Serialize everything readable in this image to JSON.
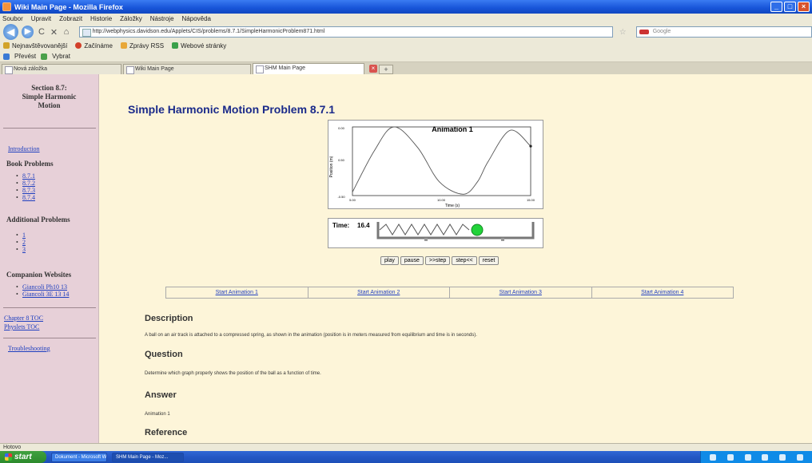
{
  "window": {
    "title": "Wiki Main Page - Mozilla Firefox",
    "controls": {
      "minimize": "_",
      "maximize": "□",
      "close": "×"
    }
  },
  "menu": [
    "Soubor",
    "Upravit",
    "Zobrazit",
    "Historie",
    "Záložky",
    "Nástroje",
    "Nápověda"
  ],
  "nav": {
    "back_icon": "back-arrow-icon",
    "forward_icon": "forward-arrow-icon",
    "url": "http://webphysics.davidson.edu/Applets/CIS/problems/8.7.1/SimpleHarmonicProblem871.html",
    "search_placeholder": "Google"
  },
  "bookmarks": [
    {
      "label": "Nejnavštěvovanější",
      "color": "#d2a42a"
    },
    {
      "label": "Začínáme",
      "color": "#d2402a"
    },
    {
      "label": "Zprávy RSS",
      "color": "#e8a83a"
    },
    {
      "label": "Webové stránky",
      "color": "#3aa04a"
    }
  ],
  "toolbar2": {
    "first": "Převést",
    "second": "Vybrat"
  },
  "tabs": [
    {
      "label": "Nová záložka"
    },
    {
      "label": "Wiki Main Page"
    },
    {
      "label": "SHM Main Page",
      "active": true
    }
  ],
  "sidebar": {
    "title_line1": "Section 8.7:",
    "title_line2": "Simple Harmonic",
    "title_line3": "Motion",
    "introduction": "Introduction",
    "book_problems_heading": "Book Problems",
    "book_problems": [
      "8.7.1",
      "8.7.2",
      "8.7.3",
      "8.7.4"
    ],
    "additional_problems_heading": "Additional Problems",
    "additional_problems": [
      "1",
      "2",
      "3"
    ],
    "companion_heading": "Companion Websites",
    "companion": [
      "Giancoli Ph10 13",
      "Giancoli 3E 13 14"
    ],
    "chapter_link_line1": "Chapter 8 TOC",
    "chapter_link_line2": "Physlets TOC",
    "troubleshooting": "Troubleshooting"
  },
  "main": {
    "title": "Simple Harmonic Motion Problem 8.7.1",
    "graph_title": "Animation 1",
    "y_label": "Position (m)",
    "x_label": "Time (s)",
    "y_ticks": [
      "0.00",
      "0.50",
      "-0.50"
    ],
    "x_ticks": [
      "5.00",
      "10.00",
      "15.00"
    ],
    "time_label": "Time:",
    "time_value": "16.4",
    "buttons": [
      "play",
      "pause",
      ">>step",
      "step<<",
      "reset"
    ],
    "start_links": [
      "Start Animation 1",
      "Start Animation 2",
      "Start Animation 3",
      "Start Animation 4"
    ],
    "description_heading": "Description",
    "description_text": "A ball on an air track is attached to a compressed spring, as shown in the animation (position is in meters measured from equilibrium and time is in seconds).",
    "question_heading": "Question",
    "question_text": "Determine which graph properly shows the position of the ball as a function of time.",
    "answer_heading": "Answer",
    "answer_text": "Animation 1",
    "reference_heading": "Reference"
  },
  "chart_data": {
    "type": "line",
    "title": "Animation 1",
    "xlabel": "Time (s)",
    "ylabel": "Position (m)",
    "xlim": [
      0,
      16.4
    ],
    "ylim": [
      -0.5,
      0.5
    ],
    "series": [
      {
        "x": [
          0,
          2,
          3.8,
          6,
          8,
          10.2,
          11.5,
          12.5,
          14.5,
          16.4
        ],
        "values": [
          -0.45,
          0.15,
          0.5,
          0.2,
          -0.3,
          -0.48,
          -0.3,
          0.0,
          0.45,
          0.22
        ]
      }
    ]
  },
  "statusbar": {
    "text": "Hotovo"
  },
  "taskbar": {
    "start": "start",
    "items": [
      "Dokument - Microsoft Word",
      "SHM Main Page - Moz..."
    ]
  }
}
